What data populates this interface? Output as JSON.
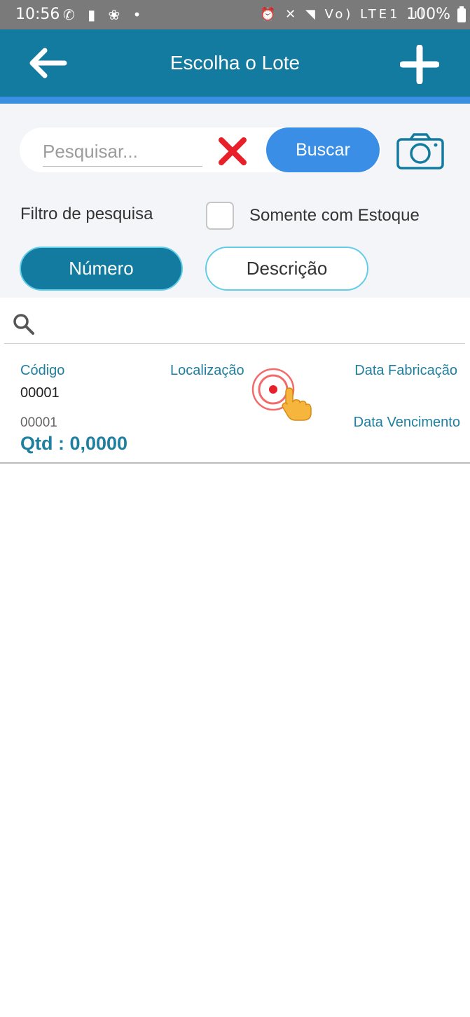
{
  "status_bar": {
    "time": "10:56",
    "left_icons": "✆ ▮ ❀ •",
    "right_icons": "⏰ ✕ ◥ Vo) LTE1 .ıl",
    "battery": "100%"
  },
  "app_bar": {
    "title": "Escolha o Lote",
    "back_icon": "arrow-left-icon",
    "add_icon": "plus-icon",
    "color": "#137b9f"
  },
  "search": {
    "placeholder": "Pesquisar...",
    "value": "",
    "button_label": "Buscar",
    "clear_icon": "close-x-icon",
    "camera_icon": "camera-icon"
  },
  "filters": {
    "label": "Filtro de pesquisa",
    "stock_only_label": "Somente com Estoque",
    "stock_only_checked": false,
    "tabs": [
      {
        "label": "Número",
        "selected": true
      },
      {
        "label": "Descrição",
        "selected": false
      }
    ]
  },
  "list": {
    "search_icon": "magnifier-icon",
    "items": [
      {
        "codigo_label": "Código",
        "codigo": "00001",
        "localizacao_label": "Localização",
        "fabricacao_label": "Data Fabricação",
        "descricao": "00001",
        "vencimento_label": "Data Vencimento",
        "qtd": "Qtd : 0,0000"
      }
    ]
  },
  "colors": {
    "primary": "#137b9f",
    "button_blue": "#3a8ee6",
    "accent_border": "#63cde8",
    "clear_red": "#e8202a"
  }
}
